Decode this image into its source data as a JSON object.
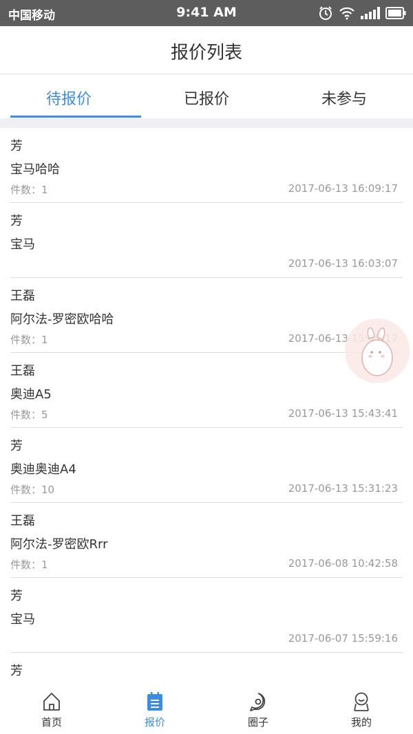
{
  "status_bar": {
    "carrier": "中国移动",
    "time": "9:41 AM",
    "icons": [
      "alarm-icon",
      "wifi-icon",
      "signal-icon",
      "battery-icon"
    ]
  },
  "header": {
    "title": "报价列表"
  },
  "tabs": [
    {
      "label": "待报价",
      "active": true
    },
    {
      "label": "已报价",
      "active": false
    },
    {
      "label": "未参与",
      "active": false
    }
  ],
  "quote_list": [
    {
      "name": "芳",
      "car": "宝马哈哈",
      "count": "件数：1",
      "date": "2017-06-13 16:09:17"
    },
    {
      "name": "芳",
      "car": "宝马",
      "count": "",
      "date": "2017-06-13 16:03:07"
    },
    {
      "name": "王磊",
      "car": "阿尔法-罗密欧哈哈",
      "count": "件数：1",
      "date": "2017-06-13 15:47:17"
    },
    {
      "name": "王磊",
      "car": "奥迪A5",
      "count": "件数：5",
      "date": "2017-06-13 15:43:41"
    },
    {
      "name": "芳",
      "car": "奥迪奥迪A4",
      "count": "件数：10",
      "date": "2017-06-13 15:31:23"
    },
    {
      "name": "王磊",
      "car": "阿尔法-罗密欧Rrr",
      "count": "件数：1",
      "date": "2017-06-08 10:42:58"
    },
    {
      "name": "芳",
      "car": "宝马",
      "count": "",
      "date": "2017-06-07 15:59:16"
    },
    {
      "name": "芳",
      "car": "",
      "count": "",
      "date": ""
    }
  ],
  "bottom_tabs": [
    {
      "label": "首页",
      "icon": "home-icon",
      "active": false
    },
    {
      "label": "报价",
      "icon": "quote-list-icon",
      "active": true
    },
    {
      "label": "圈子",
      "icon": "circle-chat-icon",
      "active": false
    },
    {
      "label": "我的",
      "icon": "profile-icon",
      "active": false
    }
  ],
  "colors": {
    "accent": "#3c8de0",
    "status_bar": "#5d5d5d",
    "muted_text": "#999999",
    "divider": "#dcdcdc"
  }
}
